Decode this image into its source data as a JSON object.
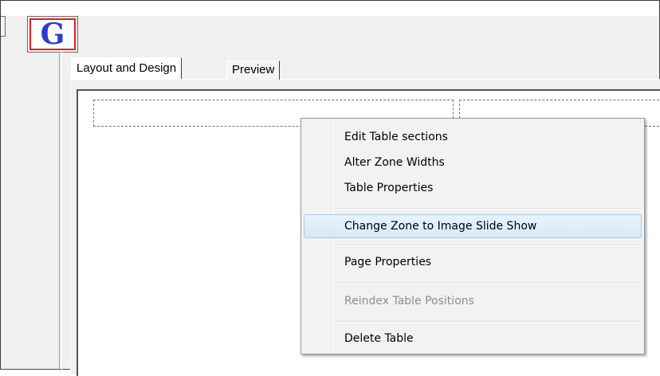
{
  "toolbar": {
    "logo_letter": "G"
  },
  "tabs": [
    {
      "label": "Layout and Design",
      "active": true
    },
    {
      "label": "Preview",
      "active": false
    }
  ],
  "context_menu": {
    "items": [
      {
        "label": "Edit Table sections",
        "enabled": true
      },
      {
        "label": "Alter Zone Widths",
        "enabled": true
      },
      {
        "label": "Table Properties",
        "enabled": true
      },
      {
        "label": "Change Zone to Image Slide Show",
        "enabled": true,
        "highlighted": true
      },
      {
        "label": "Page Properties",
        "enabled": true
      },
      {
        "label": "Reindex Table Positions",
        "enabled": false
      },
      {
        "label": "Delete Table",
        "enabled": true
      }
    ]
  },
  "colors": {
    "logo_letter": "#2a3dd0",
    "logo_border": "#e31d1d",
    "menu_highlight": "#d7e9f7"
  }
}
